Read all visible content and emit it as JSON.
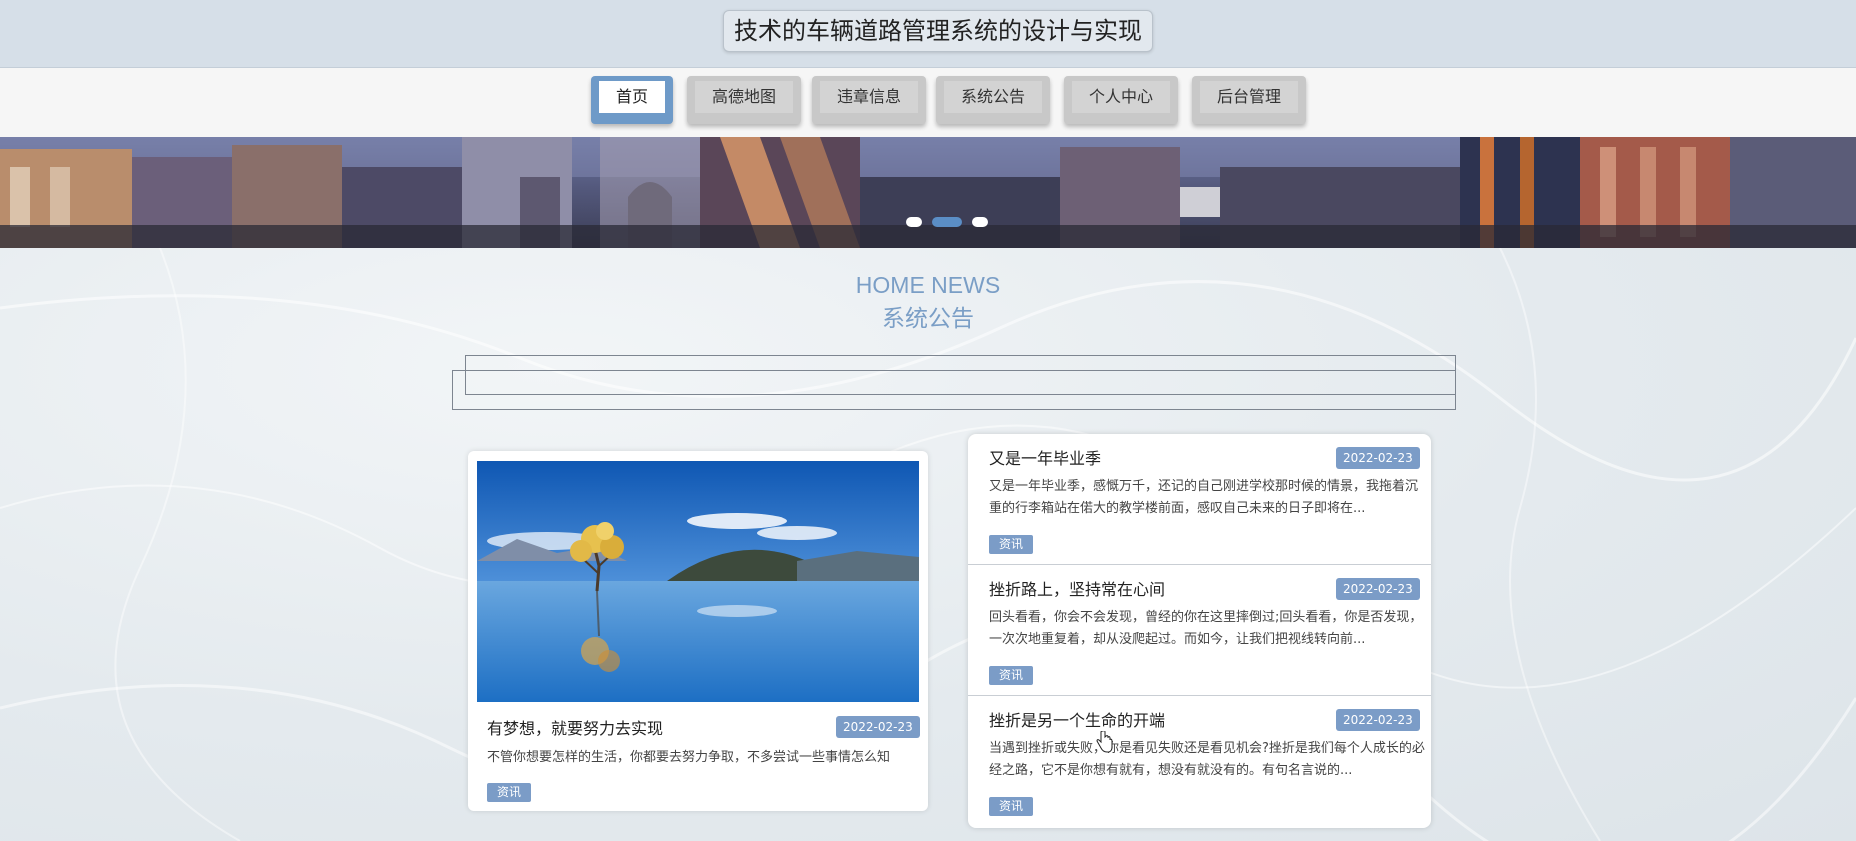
{
  "header": {
    "title": "技术的车辆道路管理系统的设计与实现"
  },
  "nav": {
    "items": [
      {
        "label": "首页",
        "active": true
      },
      {
        "label": "高德地图",
        "active": false
      },
      {
        "label": "违章信息",
        "active": false
      },
      {
        "label": "系统公告",
        "active": false
      },
      {
        "label": "个人中心",
        "active": false
      },
      {
        "label": "后台管理",
        "active": false
      }
    ]
  },
  "banner": {
    "slide_count": 3,
    "active_slide": 2
  },
  "section": {
    "title_en": "HOME NEWS",
    "title_cn": "系统公告"
  },
  "featured": {
    "title": "有梦想，就要努力去实现",
    "date": "2022-02-23",
    "description": "不管你想要怎样的生活，你都要去努力争取，不多尝试一些事情怎么知",
    "tag": "资讯"
  },
  "news": [
    {
      "title": "又是一年毕业季",
      "date": "2022-02-23",
      "description": "又是一年毕业季，感慨万千，还记的自己刚进学校那时候的情景，我拖着沉重的行李箱站在偌大的教学楼前面，感叹自己未来的日子即将在...",
      "tag": "资讯"
    },
    {
      "title": "挫折路上，坚持常在心间",
      "date": "2022-02-23",
      "description": "回头看看，你会不会发现，曾经的你在这里摔倒过;回头看看，你是否发现，一次次地重复着，却从没爬起过。而如今，让我们把视线转向前...",
      "tag": "资讯"
    },
    {
      "title": "挫折是另一个生命的开端",
      "date": "2022-02-23",
      "description": "当遇到挫折或失败，你是看见失败还是看见机会?挫折是我们每个人成长的必经之路，它不是你想有就有，想没有就没有的。有句名言说的...",
      "tag": "资讯"
    }
  ],
  "colors": {
    "accent": "#7b9cc7",
    "nav_active": "#6e9ac8",
    "section_title": "#7a9ec6"
  },
  "icons": {
    "cursor": "hand-pointer-icon"
  }
}
